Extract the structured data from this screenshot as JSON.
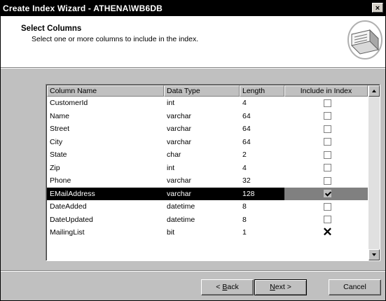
{
  "window": {
    "title": "Create Index Wizard - ATHENA\\WB6DB",
    "close_glyph": "×"
  },
  "header": {
    "title": "Select Columns",
    "subtitle": "Select one or more columns to include in the index.",
    "icon": "wizard-document-icon"
  },
  "grid": {
    "columns": [
      "Column Name",
      "Data Type",
      "Length",
      "Include in Index"
    ],
    "rows": [
      {
        "name": "CustomerId",
        "type": "int",
        "length": "4",
        "include": "unchecked",
        "selected": false
      },
      {
        "name": "Name",
        "type": "varchar",
        "length": "64",
        "include": "unchecked",
        "selected": false
      },
      {
        "name": "Street",
        "type": "varchar",
        "length": "64",
        "include": "unchecked",
        "selected": false
      },
      {
        "name": "City",
        "type": "varchar",
        "length": "64",
        "include": "unchecked",
        "selected": false
      },
      {
        "name": "State",
        "type": "char",
        "length": "2",
        "include": "unchecked",
        "selected": false
      },
      {
        "name": "Zip",
        "type": "int",
        "length": "4",
        "include": "unchecked",
        "selected": false
      },
      {
        "name": "Phone",
        "type": "varchar",
        "length": "32",
        "include": "unchecked",
        "selected": false
      },
      {
        "name": "EMailAddress",
        "type": "varchar",
        "length": "128",
        "include": "checked",
        "selected": true
      },
      {
        "name": "DateAdded",
        "type": "datetime",
        "length": "8",
        "include": "unchecked",
        "selected": false
      },
      {
        "name": "DateUpdated",
        "type": "datetime",
        "length": "8",
        "include": "unchecked",
        "selected": false
      },
      {
        "name": "MailingList",
        "type": "bit",
        "length": "1",
        "include": "disabled",
        "selected": false
      }
    ],
    "disabled_glyph": "✕"
  },
  "buttons": {
    "back_prefix": "< ",
    "back_hotkey": "B",
    "back_rest": "ack",
    "next_hotkey": "N",
    "next_rest": "ext >",
    "cancel": "Cancel"
  }
}
